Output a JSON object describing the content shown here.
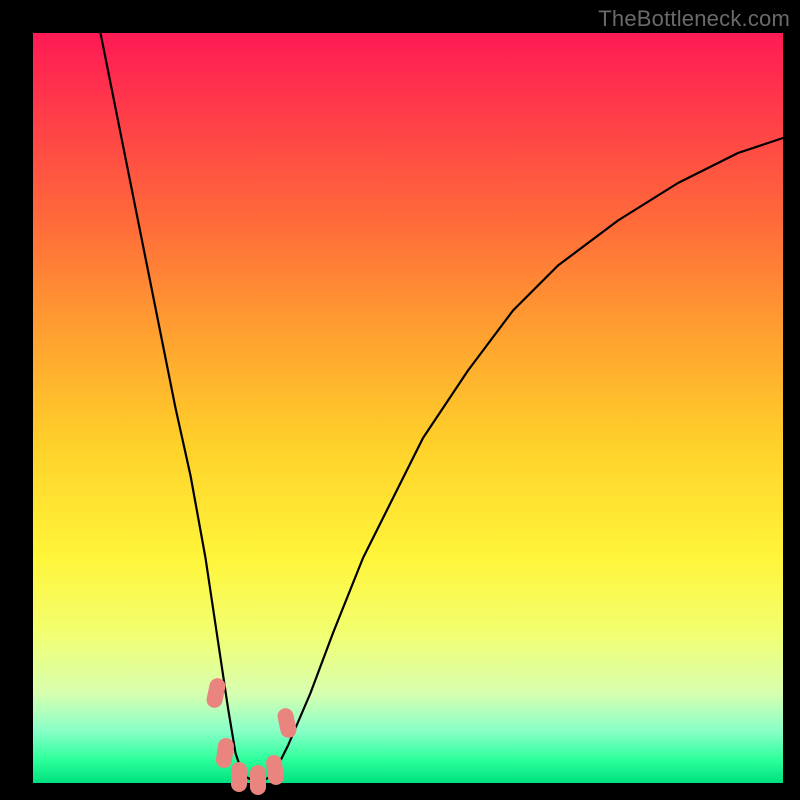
{
  "watermark": "TheBottleneck.com",
  "chart_data": {
    "type": "line",
    "title": "",
    "xlabel": "",
    "ylabel": "",
    "xlim": [
      0,
      100
    ],
    "ylim": [
      0,
      100
    ],
    "series": [
      {
        "name": "bottleneck-curve",
        "x": [
          9,
          11,
          13,
          15,
          17,
          19,
          21,
          23,
          24.5,
          26,
          27,
          28,
          30,
          32,
          34,
          37,
          40,
          44,
          48,
          52,
          58,
          64,
          70,
          78,
          86,
          94,
          100
        ],
        "y": [
          100,
          90,
          80,
          70,
          60,
          50,
          41,
          30,
          20,
          10,
          4,
          1,
          0,
          1,
          5,
          12,
          20,
          30,
          38,
          46,
          55,
          63,
          69,
          75,
          80,
          84,
          86
        ]
      }
    ],
    "markers": [
      {
        "x": 24.4,
        "y": 12
      },
      {
        "x": 25.6,
        "y": 4
      },
      {
        "x": 27.5,
        "y": 0.8
      },
      {
        "x": 30.0,
        "y": 0.4
      },
      {
        "x": 32.3,
        "y": 1.8
      },
      {
        "x": 33.8,
        "y": 8
      }
    ],
    "gradient_stops": [
      {
        "pct": 0,
        "color": "#ff1a55"
      },
      {
        "pct": 70,
        "color": "#fff53a"
      },
      {
        "pct": 100,
        "color": "#00e080"
      }
    ]
  }
}
